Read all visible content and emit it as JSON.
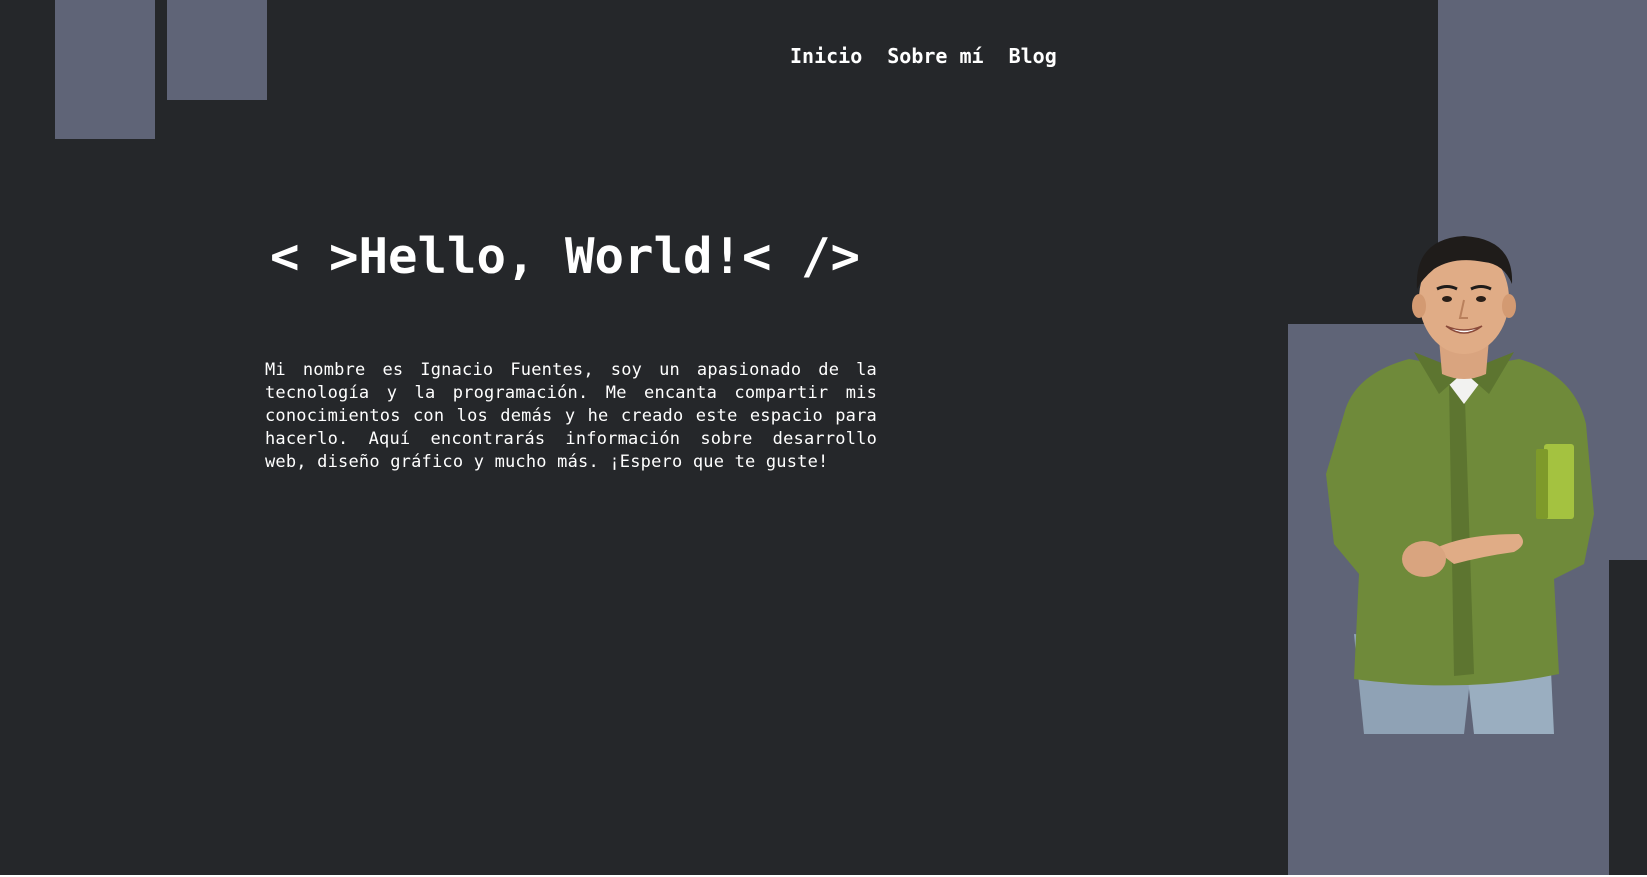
{
  "nav": {
    "items": [
      {
        "label": "Inicio"
      },
      {
        "label": "Sobre mí"
      },
      {
        "label": "Blog"
      }
    ]
  },
  "hero": {
    "title": "< >Hello, World!< />",
    "intro": "Mi nombre es Ignacio Fuentes, soy un apasionado de la tecnología y la programación. Me encanta compartir mis conocimientos con los demás y he creado este espacio para hacerlo. Aquí encontrarás información sobre desarrollo web, diseño gráfico y mucho más. ¡Espero que te guste!"
  },
  "colors": {
    "background": "#25272a",
    "accent_blocks": "#5f6477",
    "text": "#ffffff",
    "shirt": "#6f8a3a"
  }
}
